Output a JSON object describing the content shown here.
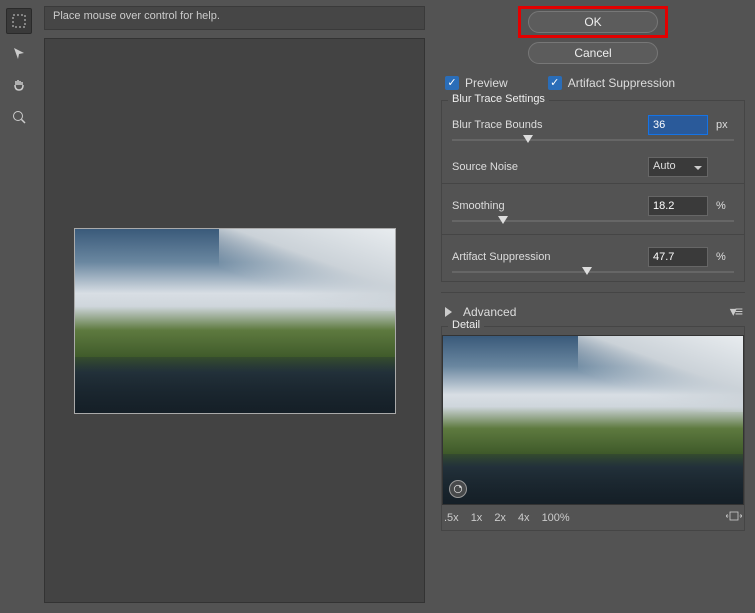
{
  "hint": "Place mouse over control for help.",
  "buttons": {
    "ok": "OK",
    "cancel": "Cancel"
  },
  "checks": {
    "preview": "Preview",
    "artifact": "Artifact Suppression"
  },
  "group1": {
    "title": "Blur Trace Settings",
    "bounds_label": "Blur Trace Bounds",
    "bounds_value": "36",
    "bounds_unit": "px",
    "noise_label": "Source Noise",
    "noise_value": "Auto",
    "smoothing_label": "Smoothing",
    "smoothing_value": "18.2",
    "smoothing_unit": "%",
    "artsup_label": "Artifact Suppression",
    "artsup_value": "47.7",
    "artsup_unit": "%"
  },
  "advanced": "Advanced",
  "detail": {
    "title": "Detail"
  },
  "zoom": {
    "a": ".5x",
    "b": "1x",
    "c": "2x",
    "d": "4x",
    "e": "100%"
  },
  "sliders": {
    "bounds_pct": 27,
    "smoothing_pct": 18,
    "artsup_pct": 48
  }
}
